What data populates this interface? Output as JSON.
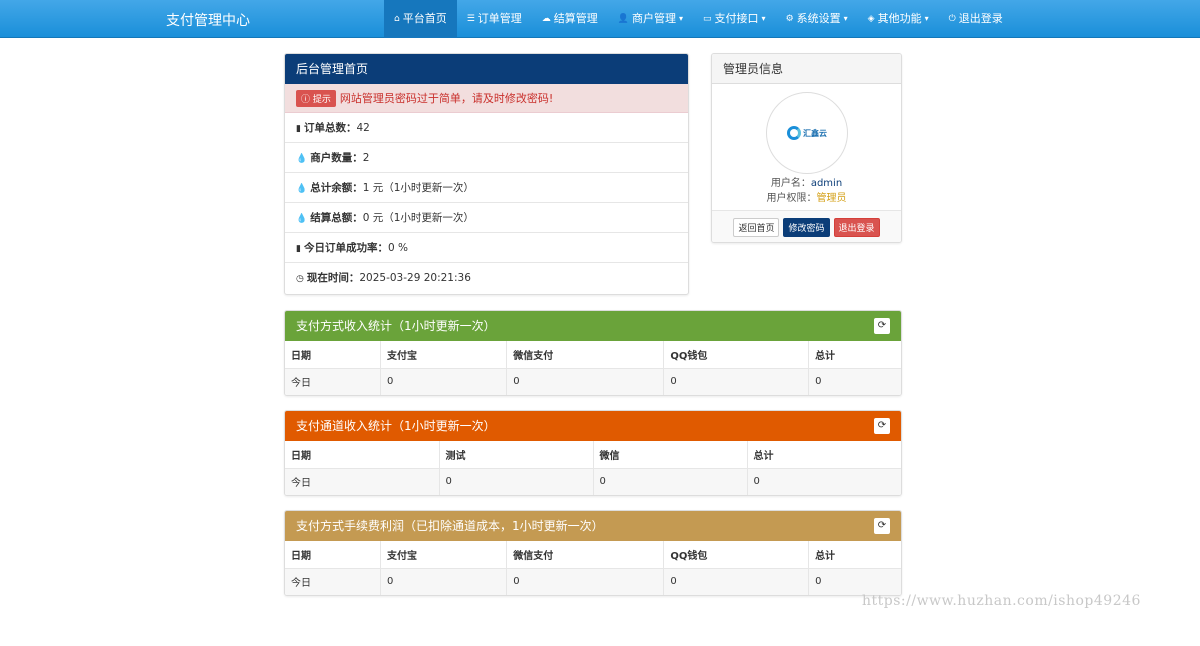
{
  "navbar": {
    "brand": "支付管理中心",
    "items": [
      {
        "icon": "home-icon",
        "glyph": "⌂",
        "label": "平台首页",
        "active": true
      },
      {
        "icon": "list-icon",
        "glyph": "☰",
        "label": "订单管理"
      },
      {
        "icon": "cloud-icon",
        "glyph": "☁",
        "label": "结算管理"
      },
      {
        "icon": "user-icon",
        "glyph": "👤",
        "label": "商户管理",
        "caret": "▾"
      },
      {
        "icon": "credit-card-icon",
        "glyph": "▭",
        "label": "支付接口",
        "caret": "▾"
      },
      {
        "icon": "cog-icon",
        "glyph": "⚙",
        "label": "系统设置",
        "caret": "▾"
      },
      {
        "icon": "cube-icon",
        "glyph": "◈",
        "label": "其他功能",
        "caret": "▾"
      },
      {
        "icon": "power-icon",
        "glyph": "⏻",
        "label": "退出登录"
      }
    ]
  },
  "main_panel": {
    "title": "后台管理首页",
    "alert_label": "提示",
    "alert_text": "网站管理员密码过于简单，请及时修改密码!",
    "rows": [
      {
        "icon": "bar-chart-icon",
        "glyph": "▮",
        "label": "订单总数：",
        "value": "42"
      },
      {
        "icon": "drop-icon",
        "glyph": "💧",
        "label": "商户数量：",
        "value": "2"
      },
      {
        "icon": "drop-icon",
        "glyph": "💧",
        "label": "总计余额：",
        "value": "1 元（1小时更新一次）"
      },
      {
        "icon": "drop-icon",
        "glyph": "💧",
        "label": "结算总额：",
        "value": "0 元（1小时更新一次）"
      },
      {
        "icon": "bar-chart-icon",
        "glyph": "▮",
        "label": "今日订单成功率：",
        "value": "0 %"
      },
      {
        "icon": "clock-icon",
        "glyph": "◷",
        "label": "现在时间：",
        "value": "2025-03-29 20:21:36"
      }
    ]
  },
  "admin_panel": {
    "title": "管理员信息",
    "logo_text": "汇鑫云",
    "username_label": "用户名：",
    "username": "admin",
    "role_label": "用户权限：",
    "role": "管理员",
    "buttons": {
      "home": "返回首页",
      "change_password": "修改密码",
      "logout": "退出登录"
    }
  },
  "stats": [
    {
      "title": "支付方式收入统计（1小时更新一次）",
      "columns": [
        "日期",
        "支付宝",
        "微信支付",
        "QQ钱包",
        "总计"
      ],
      "widths": [
        "15.5%",
        "20.5%",
        "25.5%",
        "23.5%",
        "15%"
      ],
      "row": [
        "今日",
        "0",
        "0",
        "0",
        "0"
      ]
    },
    {
      "title": "支付通道收入统计（1小时更新一次）",
      "columns": [
        "日期",
        "测试",
        "微信",
        "总计"
      ],
      "widths": [
        "25%",
        "25%",
        "25%",
        "25%"
      ],
      "row": [
        "今日",
        "0",
        "0",
        "0"
      ]
    },
    {
      "title": "支付方式手续费利润（已扣除通道成本，1小时更新一次）",
      "columns": [
        "日期",
        "支付宝",
        "微信支付",
        "QQ钱包",
        "总计"
      ],
      "widths": [
        "15.5%",
        "20.5%",
        "25.5%",
        "23.5%",
        "15%"
      ],
      "row": [
        "今日",
        "0",
        "0",
        "0",
        "0"
      ]
    }
  ],
  "watermark": "https://www.huzhan.com/ishop49246"
}
